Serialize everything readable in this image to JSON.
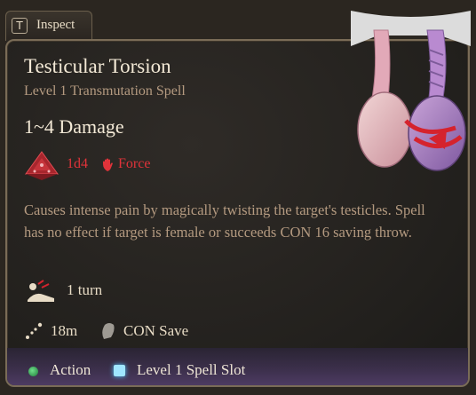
{
  "tab": {
    "key": "T",
    "label": "Inspect"
  },
  "spell": {
    "name": "Testicular Torsion",
    "subtitle": "Level 1 Transmutation Spell",
    "damage": "1~4 Damage",
    "dice": "1d4",
    "damage_type": "Force",
    "description": "Causes intense pain by magically twisting the target's testicles. Spell has no effect if target is female or succeeds CON 16 saving throw.",
    "duration": "1 turn",
    "range": "18m",
    "save": "CON Save"
  },
  "resources": {
    "action": "Action",
    "spell_slot": "Level 1 Spell Slot"
  },
  "icons": {
    "dice": "d20-dice-icon",
    "force": "force-hand-icon",
    "duration": "prone-figure-icon",
    "range": "range-icon",
    "save": "save-stone-icon"
  },
  "colors": {
    "damage_red": "#e0333a",
    "action_green": "#3fbf62",
    "spell_slot_blue": "#9fe6ff",
    "accent_purple": "#4d3b62"
  }
}
